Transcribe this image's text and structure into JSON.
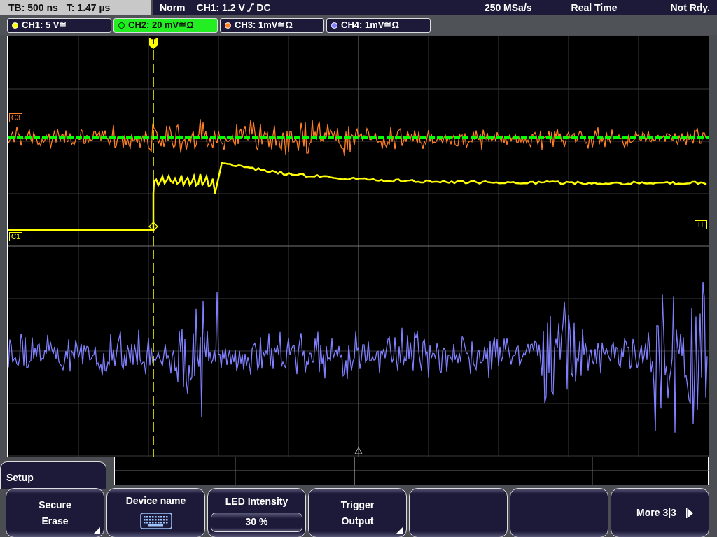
{
  "status_bar": {
    "timebase": "TB: 500 ns",
    "trigger_time": "T: 1.47 µs",
    "mode": "Norm",
    "trigger_source": "CH1: 1.2 V",
    "coupling": "DC",
    "sample_rate": "250 MSa/s",
    "acquisition": "Real Time",
    "state": "Not Rdy."
  },
  "channels": [
    {
      "label": "CH1: 5 V≅",
      "color": "#ffff00",
      "selected": false
    },
    {
      "label": "CH2: 20 mV≅Ω",
      "color": "#00ff00",
      "selected": true
    },
    {
      "label": "CH3: 1mV≅Ω",
      "color": "#ff7f27",
      "selected": false
    },
    {
      "label": "CH4: 1mV≅Ω",
      "color": "#8080ff",
      "selected": false
    }
  ],
  "screen": {
    "trigger_marker": "T",
    "markers": [
      {
        "label": "C3",
        "color": "#ff7f27"
      },
      {
        "label": "C1",
        "color": "#ffff00"
      },
      {
        "label": "TL",
        "color": "#ffff00"
      }
    ]
  },
  "menu": {
    "title": "Setup",
    "softkeys": [
      {
        "kind": "text",
        "lines": [
          "Secure",
          "Erase"
        ],
        "submenu": true
      },
      {
        "kind": "keyboard",
        "label": "Device name"
      },
      {
        "kind": "value",
        "label": "LED Intensity",
        "value": "30 %"
      },
      {
        "kind": "text",
        "lines": [
          "Trigger",
          "Output"
        ],
        "submenu": true
      },
      {
        "kind": "empty"
      },
      {
        "kind": "empty"
      },
      {
        "kind": "next",
        "label": "More 3|3"
      }
    ]
  }
}
